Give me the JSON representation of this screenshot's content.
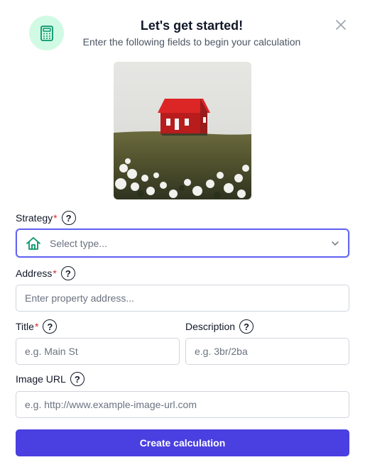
{
  "header": {
    "title": "Let's get started!",
    "subtitle": "Enter the following fields to begin your calculation",
    "icon": "calculator-icon",
    "close_icon": "close-icon"
  },
  "hero_image": {
    "alt": "Red house on a grassy hill"
  },
  "form": {
    "strategy": {
      "label": "Strategy",
      "required": "*",
      "placeholder": "Select type...",
      "icon": "home-icon"
    },
    "address": {
      "label": "Address",
      "required": "*",
      "placeholder": "Enter property address..."
    },
    "title": {
      "label": "Title",
      "required": "*",
      "placeholder": "e.g. Main St"
    },
    "description": {
      "label": "Description",
      "placeholder": "e.g. 3br/2ba"
    },
    "image_url": {
      "label": "Image URL",
      "placeholder": "e.g. http://www.example-image-url.com"
    },
    "help_glyph": "?"
  },
  "actions": {
    "submit_label": "Create calculation"
  },
  "colors": {
    "accent": "#4a3fe0",
    "focus_ring": "#6366f1",
    "required": "#dc2626",
    "icon_bg": "#d1fae5",
    "icon_fg": "#059669"
  }
}
